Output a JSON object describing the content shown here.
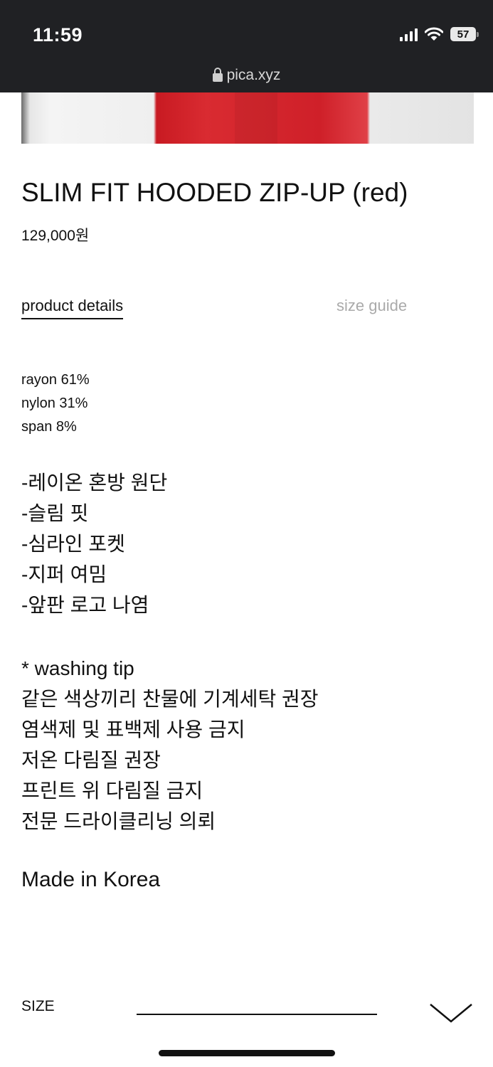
{
  "status_bar": {
    "time": "11:59",
    "battery": "57",
    "url": "pica.xyz"
  },
  "product": {
    "title": "SLIM FIT HOODED ZIP-UP (red)",
    "price": "129,000원"
  },
  "tabs": [
    {
      "label": "product details",
      "active": true
    },
    {
      "label": "size guide",
      "active": false
    }
  ],
  "composition": [
    "rayon 61%",
    "nylon 31%",
    "span 8%"
  ],
  "features": [
    "-레이온 혼방 원단",
    "-슬림 핏",
    "-심라인 포켓",
    "-지퍼 여밈",
    "-앞판 로고 나염"
  ],
  "washing": {
    "heading": "* washing tip",
    "lines": [
      "같은 색상끼리 찬물에 기계세탁 권장",
      "염색제 및 표백제 사용 금지",
      "저온 다림질 권장",
      "프린트 위 다림질 금지",
      "전문 드라이클리닝 의뢰"
    ]
  },
  "origin": "Made in Korea",
  "size_select": {
    "label": "SIZE",
    "value": ""
  },
  "icons": {
    "lock": "lock-icon",
    "chevron": "chevron-down-icon",
    "wifi": "wifi-icon",
    "signal": "signal-icon"
  },
  "colors": {
    "status_bar": "#202124",
    "product_red": "#d92b31",
    "inactive_tab": "#aaaaaa"
  }
}
